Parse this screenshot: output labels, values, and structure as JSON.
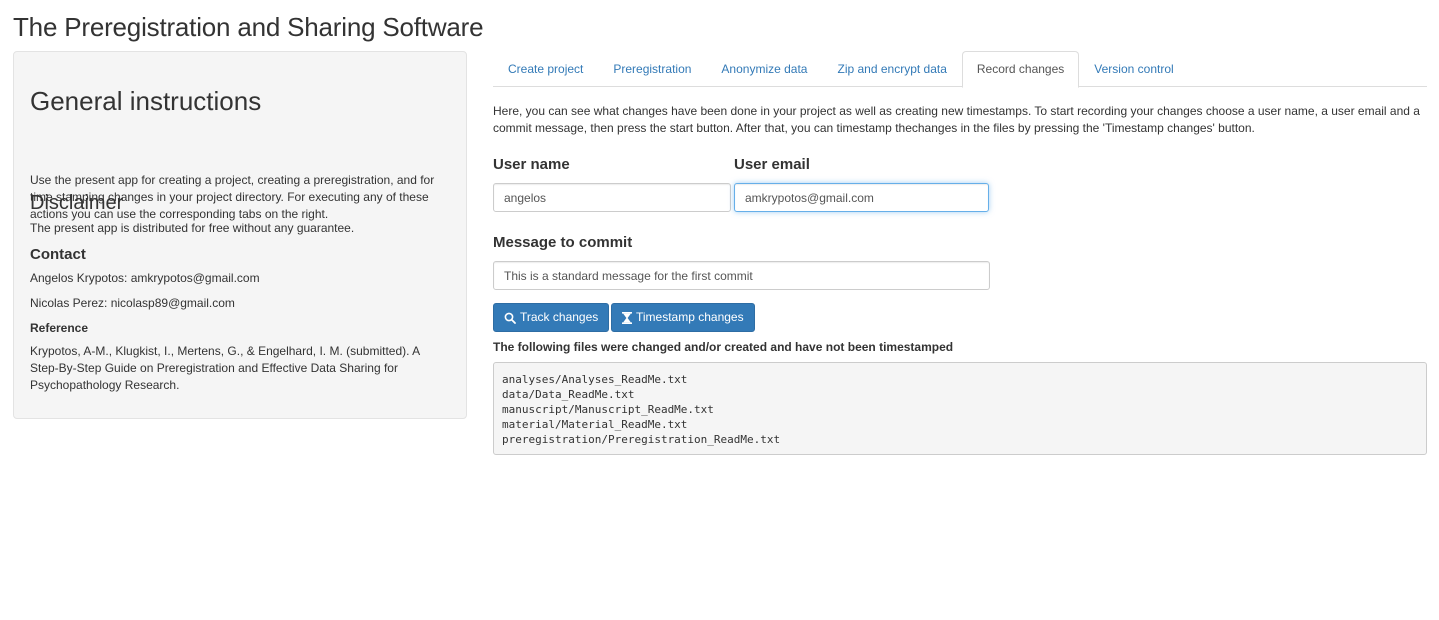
{
  "app": {
    "title": "The Preregistration and Sharing Software"
  },
  "sidebar": {
    "general_title": "General instructions",
    "general_text": "Use the present app for creating a project, creating a preregistration, and for time stamping changes in your project directory. For executing any of these actions you can use the corresponding tabs on the right.",
    "disclaimer_title": "Disclaimer",
    "disclaimer_text": "The present app is distributed for free without any guarantee.",
    "contact_title": "Contact",
    "contact_1": "Angelos Krypotos: amkrypotos@gmail.com",
    "contact_2": "Nicolas Perez: nicolasp89@gmail.com",
    "reference_title": "Reference",
    "reference_text": "Krypotos, A-M., Klugkist, I., Mertens, G., & Engelhard, I. M. (submitted). A Step-By-Step Guide on Preregistration and Effective Data Sharing for Psychopathology Research."
  },
  "tabs": [
    {
      "label": "Create project",
      "active": false
    },
    {
      "label": "Preregistration",
      "active": false
    },
    {
      "label": "Anonymize data",
      "active": false
    },
    {
      "label": "Zip and encrypt data",
      "active": false
    },
    {
      "label": "Record changes",
      "active": true
    },
    {
      "label": "Version control",
      "active": false
    }
  ],
  "main": {
    "intro": "Here, you can see what changes have been done in your project as well as creating new timestamps. To start recording your changes choose a user name, a user email and a commit message, then press the start button. After that, you can timestamp thechanges in the files by pressing the 'Timestamp changes' button.",
    "user_name_label": "User name",
    "user_name_value": "angelos",
    "user_email_label": "User email",
    "user_email_value": "amkrypotos@gmail.com",
    "message_label": "Message to commit",
    "message_value": "This is a standard message for the first commit",
    "track_button": "Track changes",
    "timestamp_button": "Timestamp changes",
    "files_heading": "The following files were changed and/or created and have not been timestamped",
    "files": [
      "analyses/Analyses_ReadMe.txt",
      "data/Data_ReadMe.txt",
      "manuscript/Manuscript_ReadMe.txt",
      "material/Material_ReadMe.txt",
      "preregistration/Preregistration_ReadMe.txt"
    ]
  },
  "icons": {
    "track": "search-icon",
    "timestamp": "hourglass-icon"
  },
  "colors": {
    "primary": "#337ab7",
    "link": "#337ab7",
    "well_bg": "#f5f5f5"
  }
}
